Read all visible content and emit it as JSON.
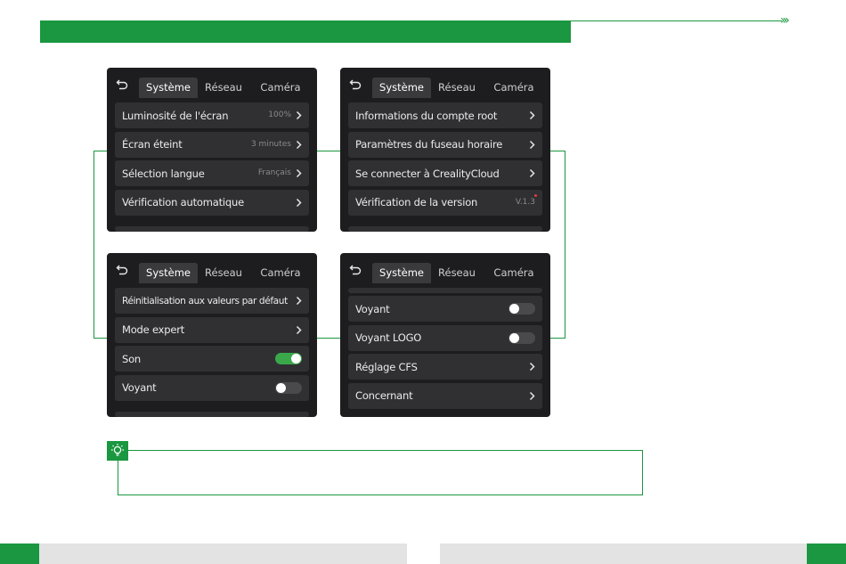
{
  "header": {
    "arrows": "›››"
  },
  "screens": [
    {
      "id": "s1",
      "tabs": {
        "tab1": "Système",
        "tab2": "Réseau",
        "tab3": "Caméra"
      },
      "rows": [
        {
          "label": "Luminosité de l'écran",
          "value": "100%"
        },
        {
          "label": "Écran éteint",
          "value": "3 minutes"
        },
        {
          "label": "Sélection langue",
          "value": "Français"
        },
        {
          "label": "Vérification automatique",
          "value": ""
        }
      ]
    },
    {
      "id": "s2",
      "tabs": {
        "tab1": "Système",
        "tab2": "Réseau",
        "tab3": "Caméra"
      },
      "rows": [
        {
          "label": "Informations du compte root",
          "value": ""
        },
        {
          "label": "Paramètres du fuseau horaire",
          "value": ""
        },
        {
          "label": "Se connecter à CrealityCloud",
          "value": ""
        },
        {
          "label": "Vérification de la version",
          "value": "V.1.3"
        }
      ]
    },
    {
      "id": "s3",
      "tabs": {
        "tab1": "Système",
        "tab2": "Réseau",
        "tab3": "Caméra"
      },
      "rows": [
        {
          "label": "Réinitialisation aux valeurs par défaut",
          "value": ""
        },
        {
          "label": "Mode expert",
          "value": ""
        },
        {
          "label": "Son",
          "value": "",
          "toggle": true
        },
        {
          "label": "Voyant",
          "value": "",
          "toggle": false
        }
      ]
    },
    {
      "id": "s4",
      "tabs": {
        "tab1": "Système",
        "tab2": "Réseau",
        "tab3": "Caméra"
      },
      "rows": [
        {
          "label": "Voyant",
          "value": "",
          "toggle": false
        },
        {
          "label": "Voyant LOGO",
          "value": "",
          "toggle": false
        },
        {
          "label": "Réglage CFS",
          "value": ""
        },
        {
          "label": "Concernant",
          "value": ""
        }
      ]
    }
  ],
  "colors": {
    "accent": "#1a9740",
    "screen_bg": "#1d1d1f",
    "row_bg": "#303033",
    "toggle_on": "#3aa84a"
  },
  "icons": {
    "back": "back-arrow-icon",
    "chevron": "chevron-right-icon",
    "tip": "lightbulb-icon"
  }
}
